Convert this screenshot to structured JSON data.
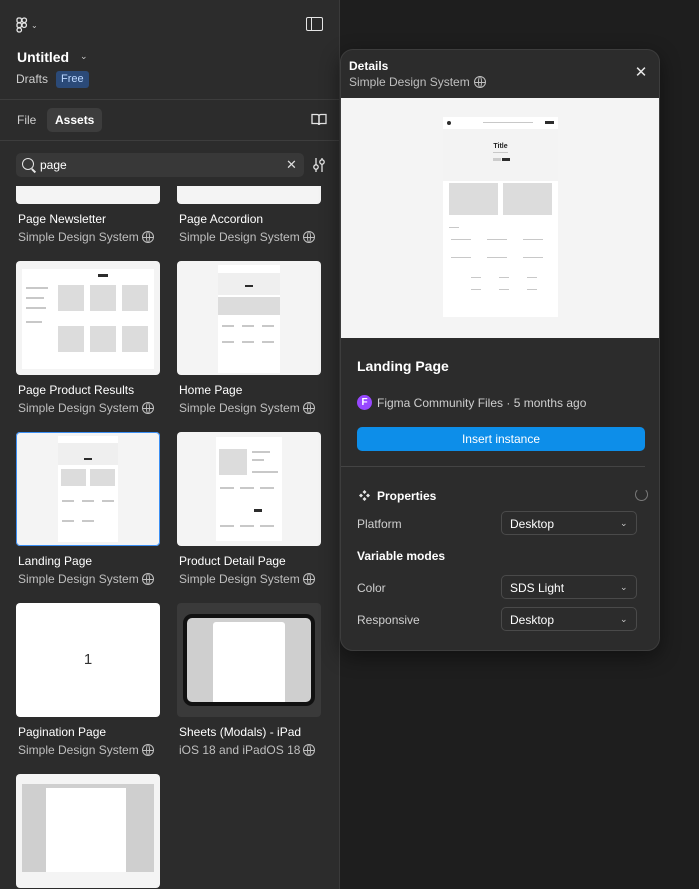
{
  "header": {
    "file_title": "Untitled",
    "location": "Drafts",
    "plan_badge": "Free"
  },
  "tabs": {
    "file": "File",
    "assets": "Assets"
  },
  "search": {
    "value": "page"
  },
  "assets": [
    {
      "title": "Page Newsletter",
      "library": "Simple Design System"
    },
    {
      "title": "Page Accordion",
      "library": "Simple Design System"
    },
    {
      "title": "Page Product Results",
      "library": "Simple Design System"
    },
    {
      "title": "Home Page",
      "library": "Simple Design System"
    },
    {
      "title": "Landing Page",
      "library": "Simple Design System"
    },
    {
      "title": "Product Detail Page",
      "library": "Simple Design System"
    },
    {
      "title": "Pagination Page",
      "library": "Simple Design System",
      "thumb_text": "1"
    },
    {
      "title": "Sheets (Modals) - iPad",
      "library": "iOS 18 and iPadOS 18"
    }
  ],
  "details": {
    "header": "Details",
    "library": "Simple Design System",
    "preview_title": "Title",
    "component_name": "Landing Page",
    "source_avatar": "F",
    "source": "Figma Community Files · 5 months ago",
    "insert_label": "Insert instance",
    "properties_title": "Properties",
    "platform_label": "Platform",
    "platform_value": "Desktop",
    "variable_modes_title": "Variable modes",
    "color_label": "Color",
    "color_value": "SDS Light",
    "responsive_label": "Responsive",
    "responsive_value": "Desktop"
  },
  "colors": {
    "panel_bg": "#2c2c2c",
    "canvas_bg": "#1e1e1e",
    "accent_blue": "#0d8ee9",
    "selection_outline": "#3b8ff4",
    "community_avatar": "#9747ff"
  },
  "icons": [
    "figma-logo-icon",
    "sidebar-toggle-icon",
    "library-book-icon",
    "search-icon",
    "clear-icon",
    "filter-icon",
    "globe-icon",
    "close-icon",
    "properties-icon",
    "reset-icon",
    "chevron-down-icon"
  ]
}
